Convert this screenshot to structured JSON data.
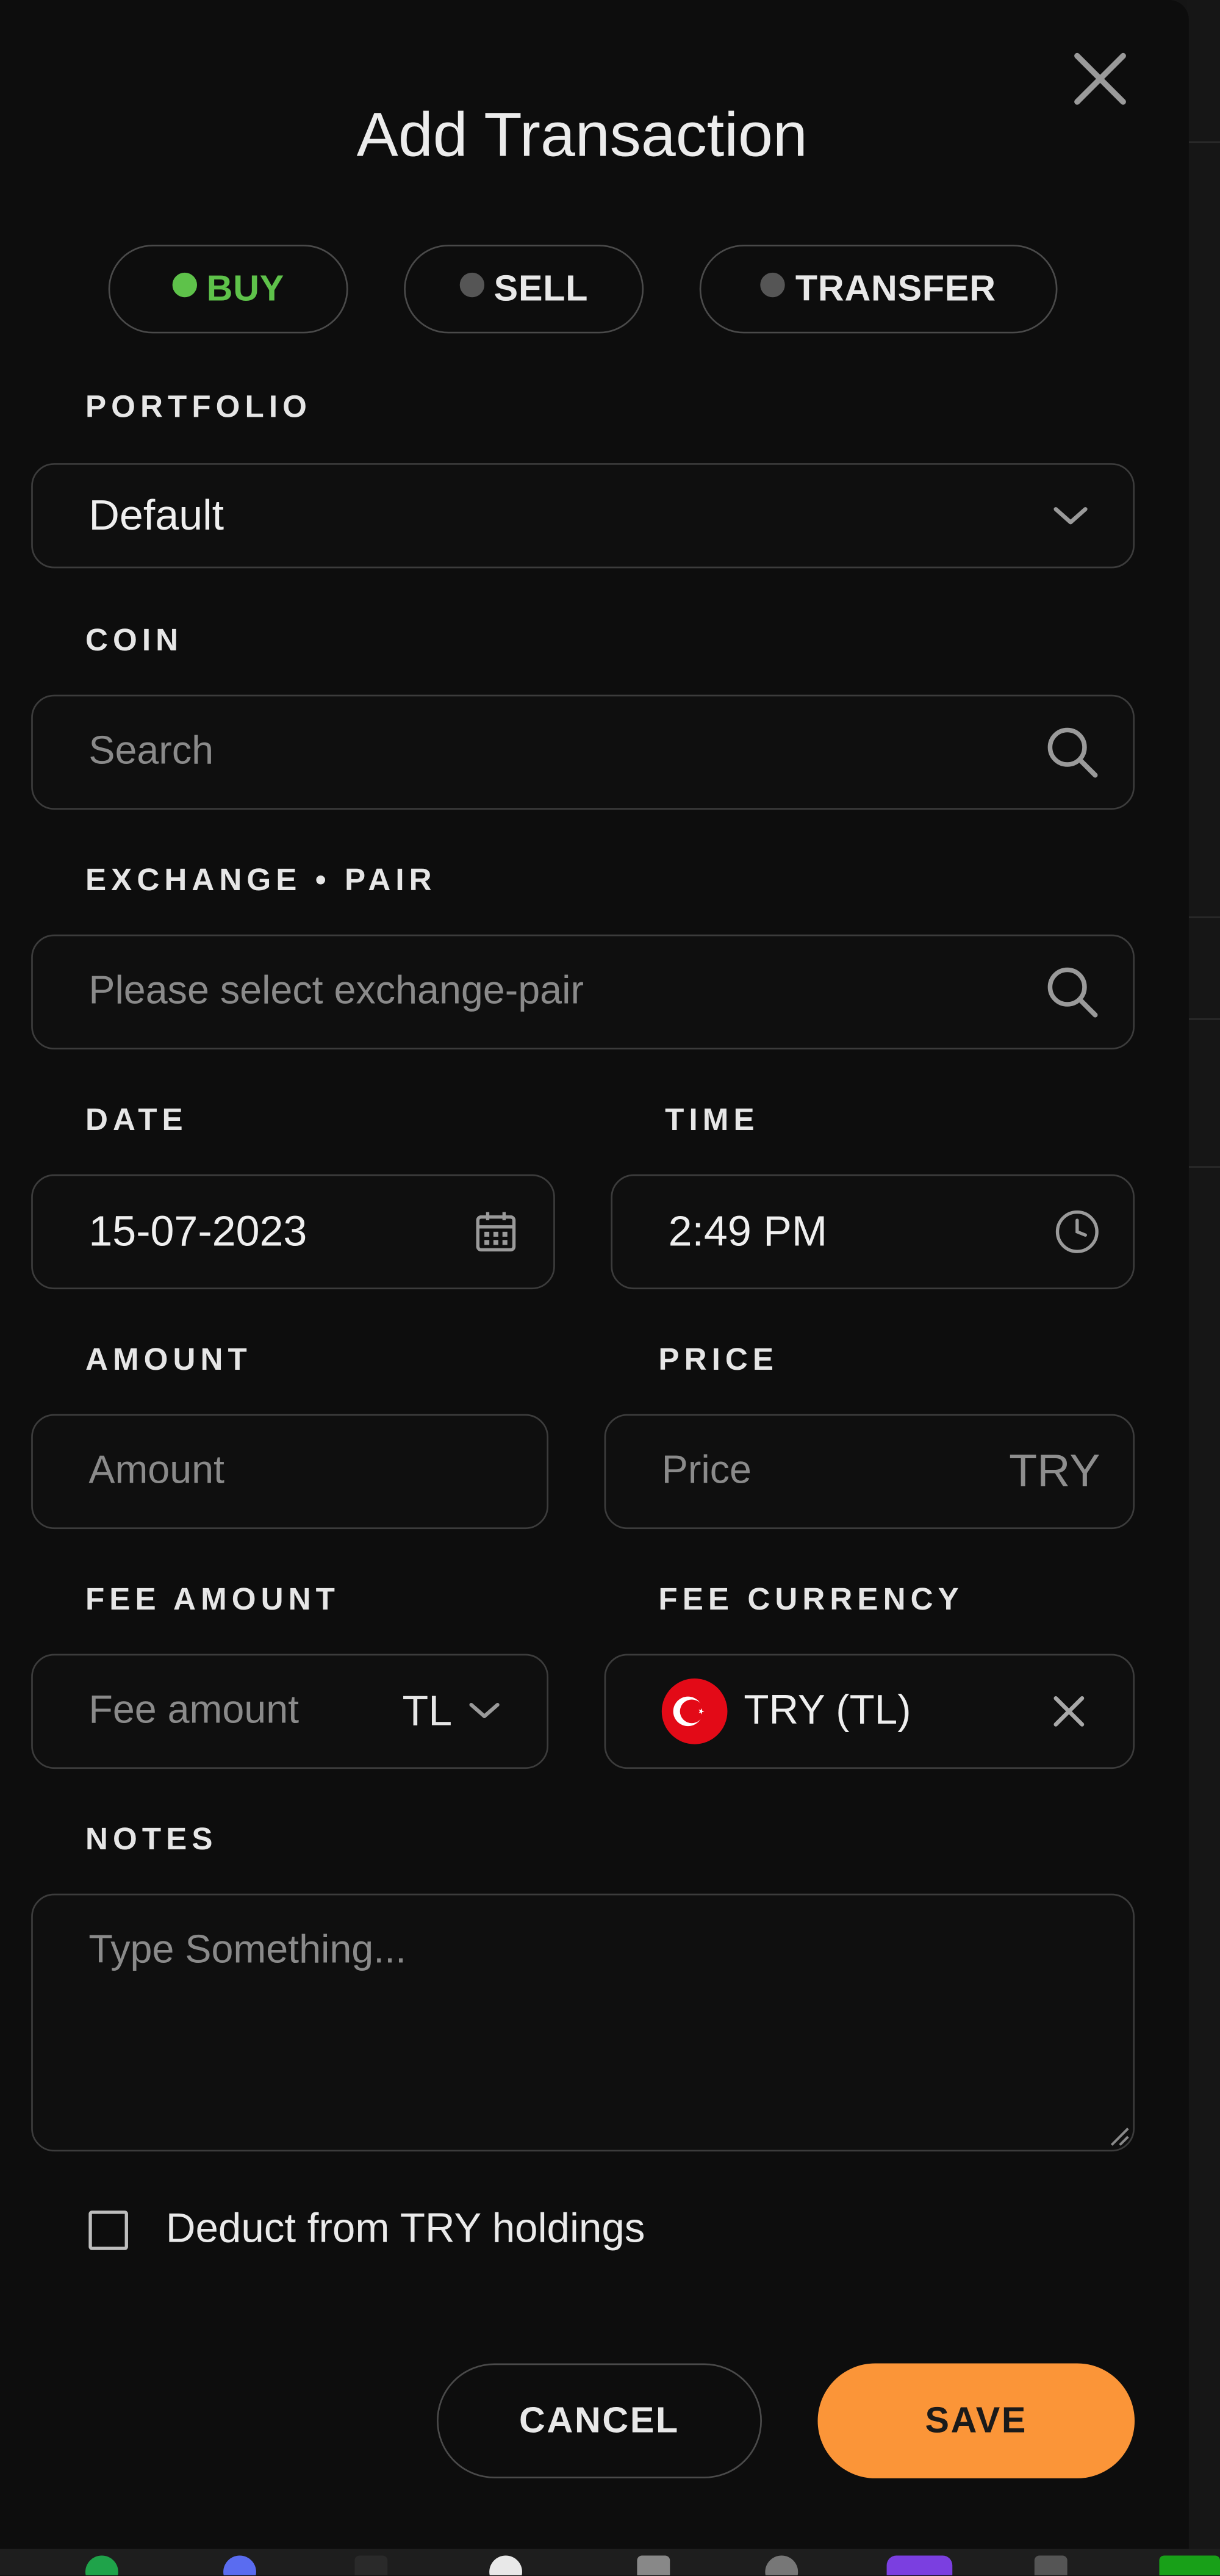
{
  "modal": {
    "title": "Add Transaction"
  },
  "tabs": [
    {
      "label": "BUY",
      "active": true
    },
    {
      "label": "SELL",
      "active": false
    },
    {
      "label": "TRANSFER",
      "active": false
    }
  ],
  "portfolio": {
    "label": "PORTFOLIO",
    "value": "Default"
  },
  "coin": {
    "label": "COIN",
    "placeholder": "Search"
  },
  "exchange_pair": {
    "label": "EXCHANGE • PAIR",
    "placeholder": "Please select exchange-pair"
  },
  "date": {
    "label": "DATE",
    "value": "15-07-2023"
  },
  "time": {
    "label": "TIME",
    "value": "2:49 PM"
  },
  "amount": {
    "label": "AMOUNT",
    "placeholder": "Amount"
  },
  "price": {
    "label": "PRICE",
    "placeholder": "Price",
    "currency": "TRY"
  },
  "fee_amount": {
    "label": "FEE AMOUNT",
    "placeholder": "Fee amount",
    "unit": "TL"
  },
  "fee_currency": {
    "label": "FEE CURRENCY",
    "value": "TRY (TL)"
  },
  "notes": {
    "label": "NOTES",
    "placeholder": "Type Something..."
  },
  "deduct": {
    "label": "Deduct from TRY holdings",
    "checked": false
  },
  "actions": {
    "cancel": "CANCEL",
    "save": "SAVE"
  },
  "colors": {
    "accent_save": "#fb9538",
    "active_tab": "#5ec24a",
    "background": "#0d0d0d",
    "flag_red": "#e30a17"
  }
}
